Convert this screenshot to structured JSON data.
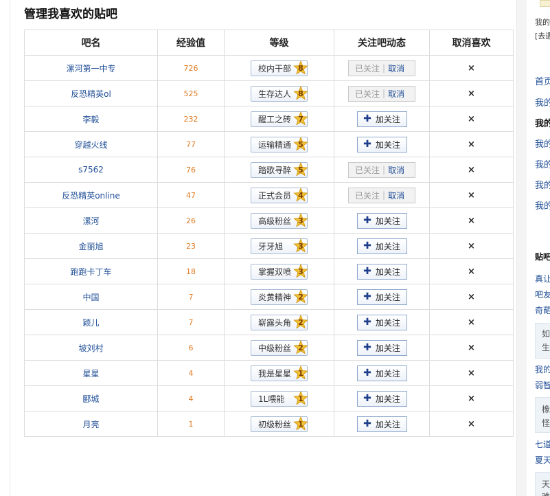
{
  "page": {
    "title": "管理我喜欢的贴吧"
  },
  "table": {
    "headers": [
      "吧名",
      "经验值",
      "等级",
      "关注吧动态",
      "取消喜欢"
    ],
    "followed_label": "已关注",
    "cancel_label": "取消",
    "follow_label": "加关注",
    "unlike_symbol": "×",
    "rows": [
      {
        "name": "漯河第一中专",
        "exp": "726",
        "level_title": "校内干部",
        "level": "8",
        "followed": true
      },
      {
        "name": "反恐精英ol",
        "exp": "525",
        "level_title": "生存达人",
        "level": "8",
        "followed": true
      },
      {
        "name": "李毅",
        "exp": "232",
        "level_title": "醒工之砖",
        "level": "7",
        "followed": false
      },
      {
        "name": "穿越火线",
        "exp": "77",
        "level_title": "运输精通",
        "level": "5",
        "followed": false
      },
      {
        "name": "s7562",
        "exp": "76",
        "level_title": "踏歌寻醉",
        "level": "5",
        "followed": true
      },
      {
        "name": "反恐精英online",
        "exp": "47",
        "level_title": "正式会员",
        "level": "4",
        "followed": true
      },
      {
        "name": "漯河",
        "exp": "26",
        "level_title": "高级粉丝",
        "level": "3",
        "followed": false
      },
      {
        "name": "金丽旭",
        "exp": "23",
        "level_title": "牙牙旭",
        "level": "3",
        "followed": false
      },
      {
        "name": "跑跑卡丁车",
        "exp": "18",
        "level_title": "掌握双喷",
        "level": "3",
        "followed": false
      },
      {
        "name": "中国",
        "exp": "7",
        "level_title": "炎黄精神",
        "level": "2",
        "followed": false
      },
      {
        "name": "颖儿",
        "exp": "7",
        "level_title": "崭露头角",
        "level": "2",
        "followed": false
      },
      {
        "name": "坡刘村",
        "exp": "6",
        "level_title": "中级粉丝",
        "level": "2",
        "followed": false
      },
      {
        "name": "星星",
        "exp": "4",
        "level_title": "我是星星",
        "level": "1",
        "followed": false
      },
      {
        "name": "郾城",
        "exp": "4",
        "level_title": "1L喂能",
        "level": "1",
        "followed": false
      },
      {
        "name": "月亮",
        "exp": "1",
        "level_title": "初级粉丝",
        "level": "1",
        "followed": false
      }
    ]
  },
  "sidebar": {
    "top_text": "我的",
    "top_link": "[去遇",
    "items": [
      "首页",
      "我的",
      "我的",
      "我的",
      "我的",
      "我的",
      "我的"
    ],
    "section_title": "贴吧",
    "lines": [
      "真让",
      "吧友",
      "奇葩",
      "如",
      "生",
      "我的",
      "弱智",
      "橡",
      "怪",
      "七道",
      "夏天",
      "天",
      "难"
    ]
  },
  "colors": {
    "link": "#1f4e96",
    "exp": "#e07a21",
    "star": "#f3c43a"
  }
}
